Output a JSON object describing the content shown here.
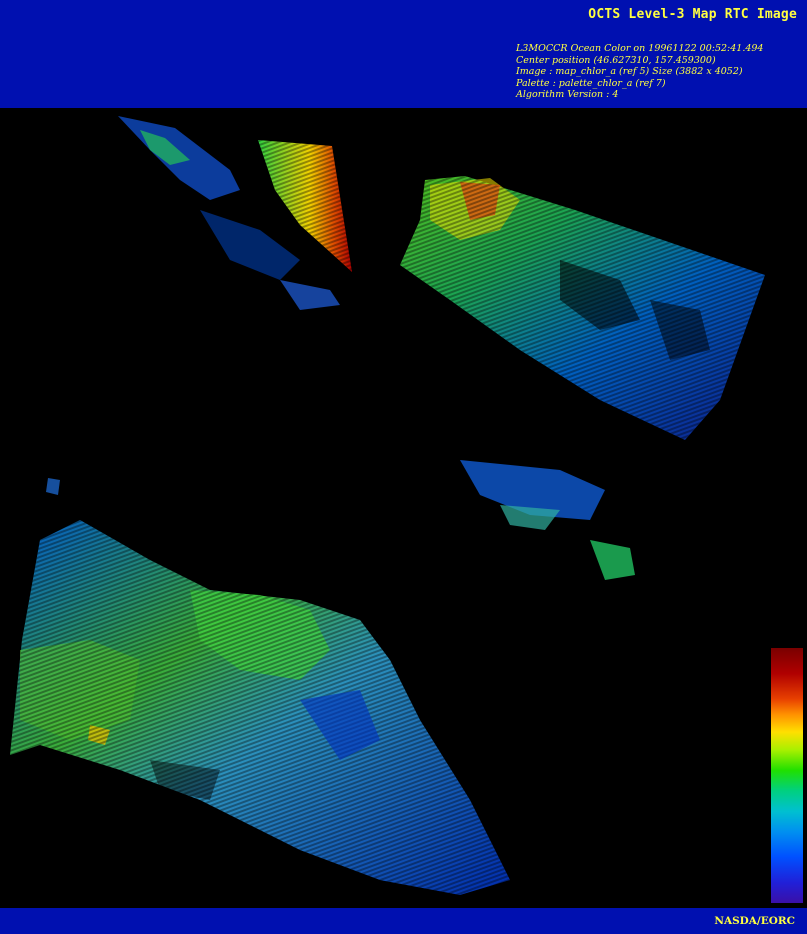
{
  "header": {
    "title": "OCTS Level-3 Map RTC Image",
    "lines": [
      "L3MOCCR Ocean Color on 19961122 00:52:41.494",
      "Center position (46.627310, 157.459300)",
      "Image : map_chlor_a (ref 5) Size (3882 x 4052)",
      "Palette : palette_chlor_a (ref 7)",
      "Algorithm Version : 4"
    ]
  },
  "colors": {
    "banner": "#0010b0",
    "banner_text": "#ffff40",
    "background": "#000000"
  },
  "footer": {
    "credit": "NASDA/EORC"
  }
}
